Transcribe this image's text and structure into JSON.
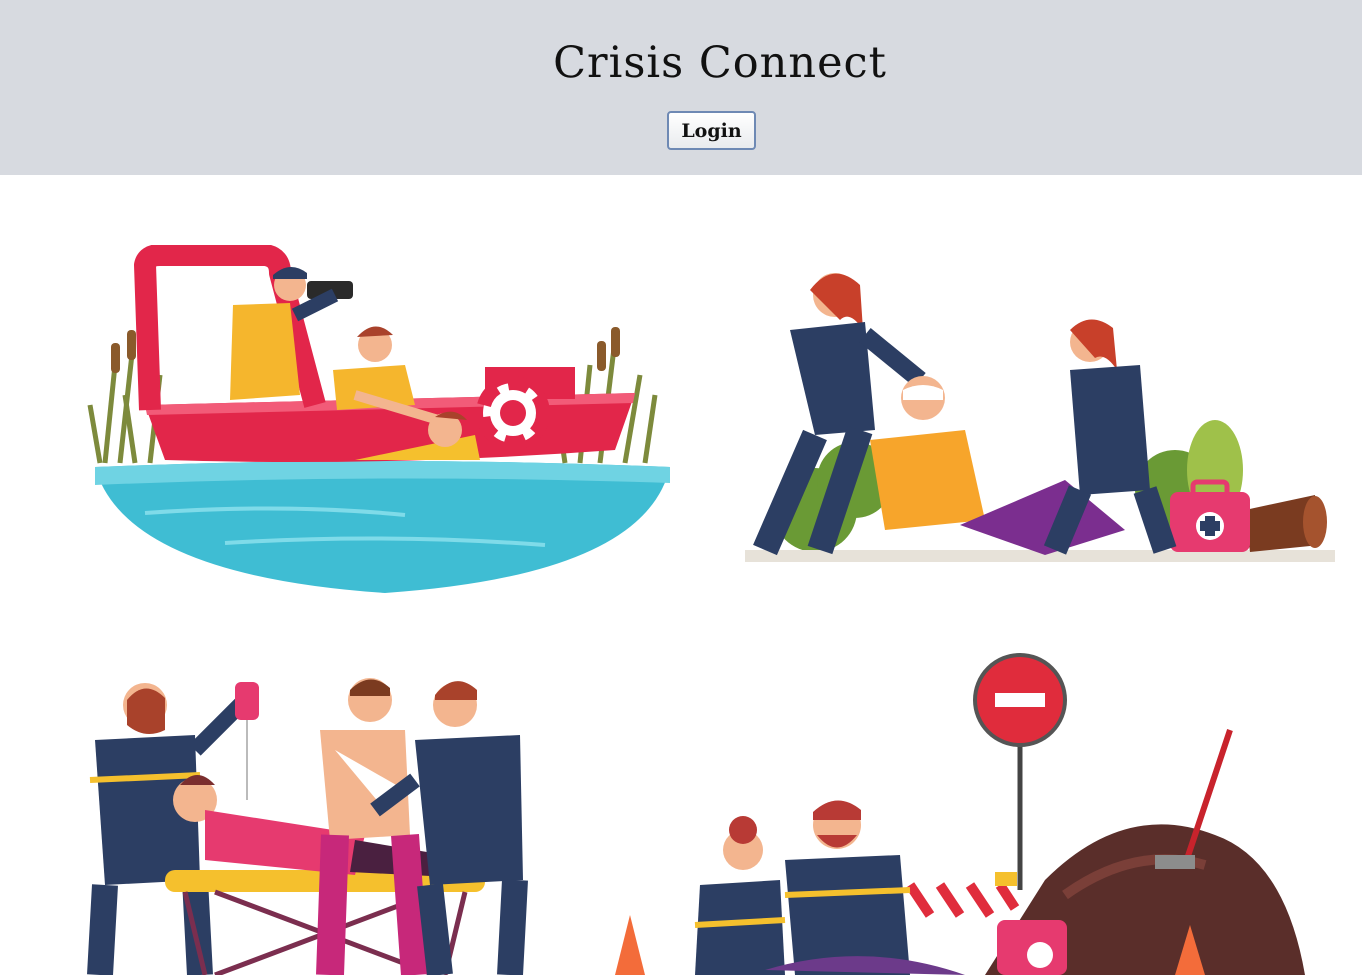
{
  "header": {
    "title": "Crisis Connect",
    "login_label": "Login",
    "background": "#d7dae0"
  },
  "illustrations": [
    {
      "icon": "boat-rescue-illustration"
    },
    {
      "icon": "first-aid-head-injury-illustration"
    },
    {
      "icon": "stretcher-iv-illustration"
    },
    {
      "icon": "road-accident-cpr-illustration"
    }
  ],
  "colors": {
    "uniform": "#2c3e63",
    "accent_red": "#e2264a",
    "water": "#4cc3d9",
    "skin": "#f3b58f",
    "vest": "#f5b62d"
  }
}
